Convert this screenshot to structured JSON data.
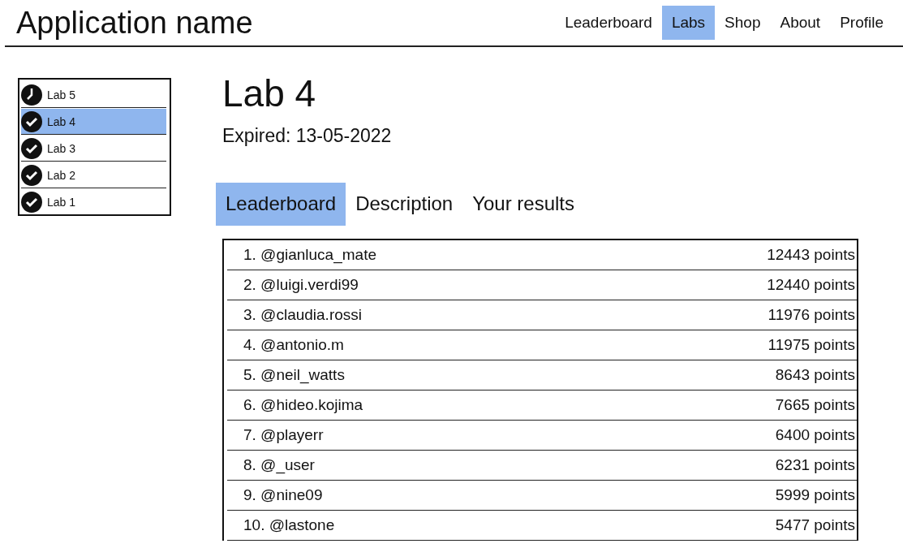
{
  "app_name": "Application name",
  "nav": [
    {
      "label": "Leaderboard",
      "selected": false
    },
    {
      "label": "Labs",
      "selected": true
    },
    {
      "label": "Shop",
      "selected": false
    },
    {
      "label": "About",
      "selected": false
    },
    {
      "label": "Profile",
      "selected": false
    }
  ],
  "sidebar": {
    "items": [
      {
        "label": "Lab 5",
        "kind": "clock",
        "selected": false
      },
      {
        "label": "Lab 4",
        "kind": "done",
        "selected": true
      },
      {
        "label": "Lab 3",
        "kind": "done",
        "selected": false
      },
      {
        "label": "Lab 2",
        "kind": "done",
        "selected": false
      },
      {
        "label": "Lab 1",
        "kind": "done",
        "selected": false
      }
    ]
  },
  "title": "Lab 4",
  "subtitle": "Expired: 13-05-2022",
  "tabs": [
    {
      "label": "Leaderboard",
      "selected": true
    },
    {
      "label": "Description",
      "selected": false
    },
    {
      "label": "Your results",
      "selected": false
    }
  ],
  "leaderboard": {
    "rows": [
      {
        "user": "1. @gianluca_mate",
        "points": "12443 points"
      },
      {
        "user": "2. @luigi.verdi99",
        "points": "12440 points"
      },
      {
        "user": "3. @claudia.rossi",
        "points": "11976 points"
      },
      {
        "user": "4. @antonio.m",
        "points": "11975 points"
      },
      {
        "user": "5. @neil_watts",
        "points": "8643 points"
      },
      {
        "user": "6. @hideo.kojima",
        "points": "7665 points"
      },
      {
        "user": "7. @playerr",
        "points": "6400 points"
      },
      {
        "user": "8. @_user",
        "points": "6231 points"
      },
      {
        "user": "9. @nine09",
        "points": "5999 points"
      },
      {
        "user": "10. @lastone",
        "points": "5477 points"
      }
    ]
  }
}
